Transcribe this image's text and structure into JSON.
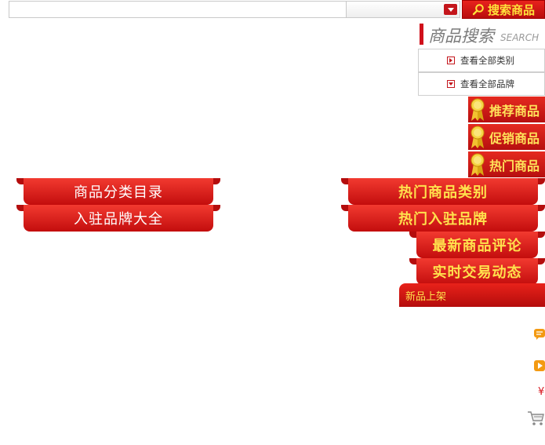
{
  "search": {
    "input_value": "",
    "button_label": "搜索商品"
  },
  "product_search": {
    "title": "商品搜索",
    "subtitle": "SEARCH",
    "links": [
      {
        "label": "查看全部类别"
      },
      {
        "label": "查看全部品牌"
      }
    ]
  },
  "tags": [
    {
      "label": "推荐商品"
    },
    {
      "label": "促销商品"
    },
    {
      "label": "热门商品"
    }
  ],
  "ribbons_left": [
    {
      "label": "商品分类目录"
    },
    {
      "label": "入驻品牌大全"
    }
  ],
  "ribbons_right": [
    {
      "label": "热门商品类别"
    },
    {
      "label": "热门入驻品牌"
    },
    {
      "label": "最新商品评论"
    },
    {
      "label": "实时交易动态"
    }
  ],
  "new_products": {
    "label": "新品上架"
  },
  "side_icons": {
    "yen_symbol": "¥",
    "icons": [
      "comment-icon",
      "play-icon",
      "yen-icon",
      "cart-icon"
    ]
  },
  "colors": {
    "brand_red": "#c4161c",
    "gold_text": "#ffe14d"
  }
}
